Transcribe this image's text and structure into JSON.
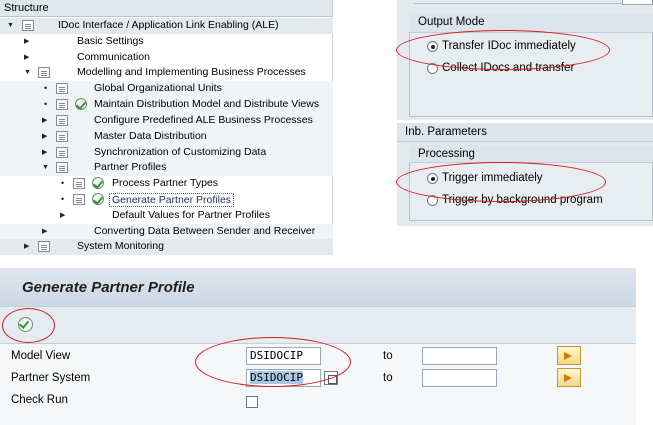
{
  "structure": {
    "header": "Structure",
    "items": [
      {
        "label": "IDoc Interface / Application Link Enabling (ALE)"
      },
      {
        "label": "Basic Settings"
      },
      {
        "label": "Communication"
      },
      {
        "label": "Modelling and Implementing Business Processes"
      },
      {
        "label": "Global Organizational Units"
      },
      {
        "label": "Maintain Distribution Model and Distribute Views"
      },
      {
        "label": "Configure Predefined ALE Business Processes"
      },
      {
        "label": "Master Data Distribution"
      },
      {
        "label": "Synchronization of Customizing Data"
      },
      {
        "label": "Partner Profiles"
      },
      {
        "label": "Process Partner Types"
      },
      {
        "label": "Generate Partner Profiles"
      },
      {
        "label": "Default Values for Partner Profiles"
      },
      {
        "label": "Converting Data Between Sender and Receiver"
      },
      {
        "label": "System Monitoring"
      }
    ]
  },
  "settings": {
    "output_mode": {
      "title": "Output Mode",
      "options": [
        {
          "label": "Transfer IDoc immediately",
          "selected": true
        },
        {
          "label": "Collect IDocs and transfer",
          "selected": false
        }
      ]
    },
    "inb_parameters": {
      "title": "Inb. Parameters",
      "processing": {
        "title": "Processing",
        "options": [
          {
            "label": "Trigger immediately",
            "selected": true
          },
          {
            "label": "Trigger by background program",
            "selected": false
          }
        ]
      }
    }
  },
  "generate_window": {
    "title": "Generate Partner Profile",
    "toolbar": {
      "execute_icon": "execute-icon"
    },
    "form": {
      "model_view": {
        "label": "Model View",
        "value": "DSIDOCIP",
        "to_label": "to",
        "to_value": ""
      },
      "partner_system": {
        "label": "Partner System",
        "value": "DSIDOCIP",
        "to_label": "to",
        "to_value": ""
      },
      "check_run": {
        "label": "Check Run",
        "checked": false
      }
    }
  },
  "colors": {
    "highlight_ellipse": "#d21f1f",
    "title_bar": "#cdd8e3",
    "panel": "#e3e9ef"
  }
}
